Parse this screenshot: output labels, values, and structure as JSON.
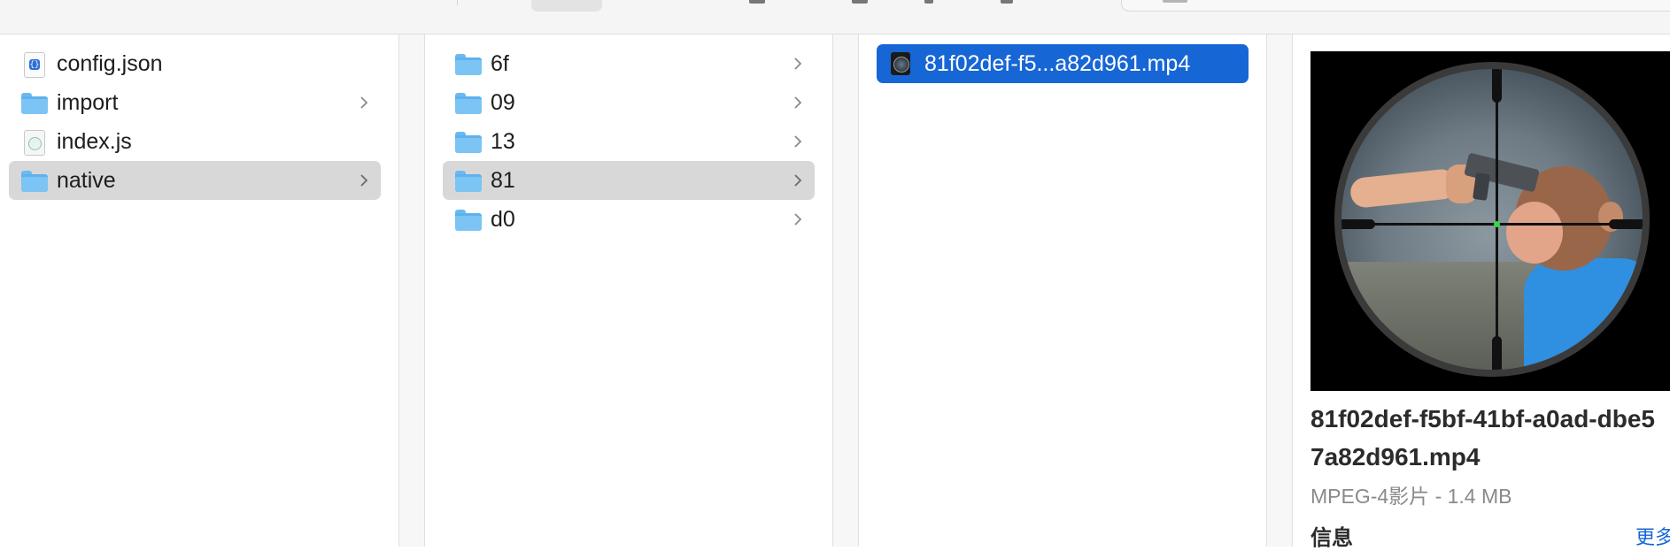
{
  "columns": [
    {
      "items": [
        {
          "label": "config.json",
          "icon": "json-file-icon",
          "selected": false,
          "has_children": false
        },
        {
          "label": "import",
          "icon": "folder-icon",
          "selected": false,
          "has_children": true
        },
        {
          "label": "index.js",
          "icon": "js-file-icon",
          "selected": false,
          "has_children": false
        },
        {
          "label": "native",
          "icon": "folder-icon",
          "selected": true,
          "has_children": true
        }
      ]
    },
    {
      "items": [
        {
          "label": "6f",
          "icon": "folder-icon",
          "selected": false,
          "has_children": true
        },
        {
          "label": "09",
          "icon": "folder-icon",
          "selected": false,
          "has_children": true
        },
        {
          "label": "13",
          "icon": "folder-icon",
          "selected": false,
          "has_children": true
        },
        {
          "label": "81",
          "icon": "folder-icon",
          "selected": true,
          "has_children": true
        },
        {
          "label": "d0",
          "icon": "folder-icon",
          "selected": false,
          "has_children": true
        }
      ]
    },
    {
      "items": [
        {
          "label": "81f02def-f5...a82d961.mp4",
          "icon": "video-thumbnail-icon",
          "selected": true,
          "has_children": false
        }
      ]
    }
  ],
  "preview": {
    "filename": "81f02def-f5bf-41bf-a0ad-dbe57a82d961.mp4",
    "kind_size": "MPEG-4影片 - 1.4 MB",
    "info_heading": "信息",
    "more_link": "更多"
  },
  "colors": {
    "selection_blue": "#1766d6",
    "selection_gray": "#d8d8d8",
    "folder_blue": "#5db1ed"
  }
}
